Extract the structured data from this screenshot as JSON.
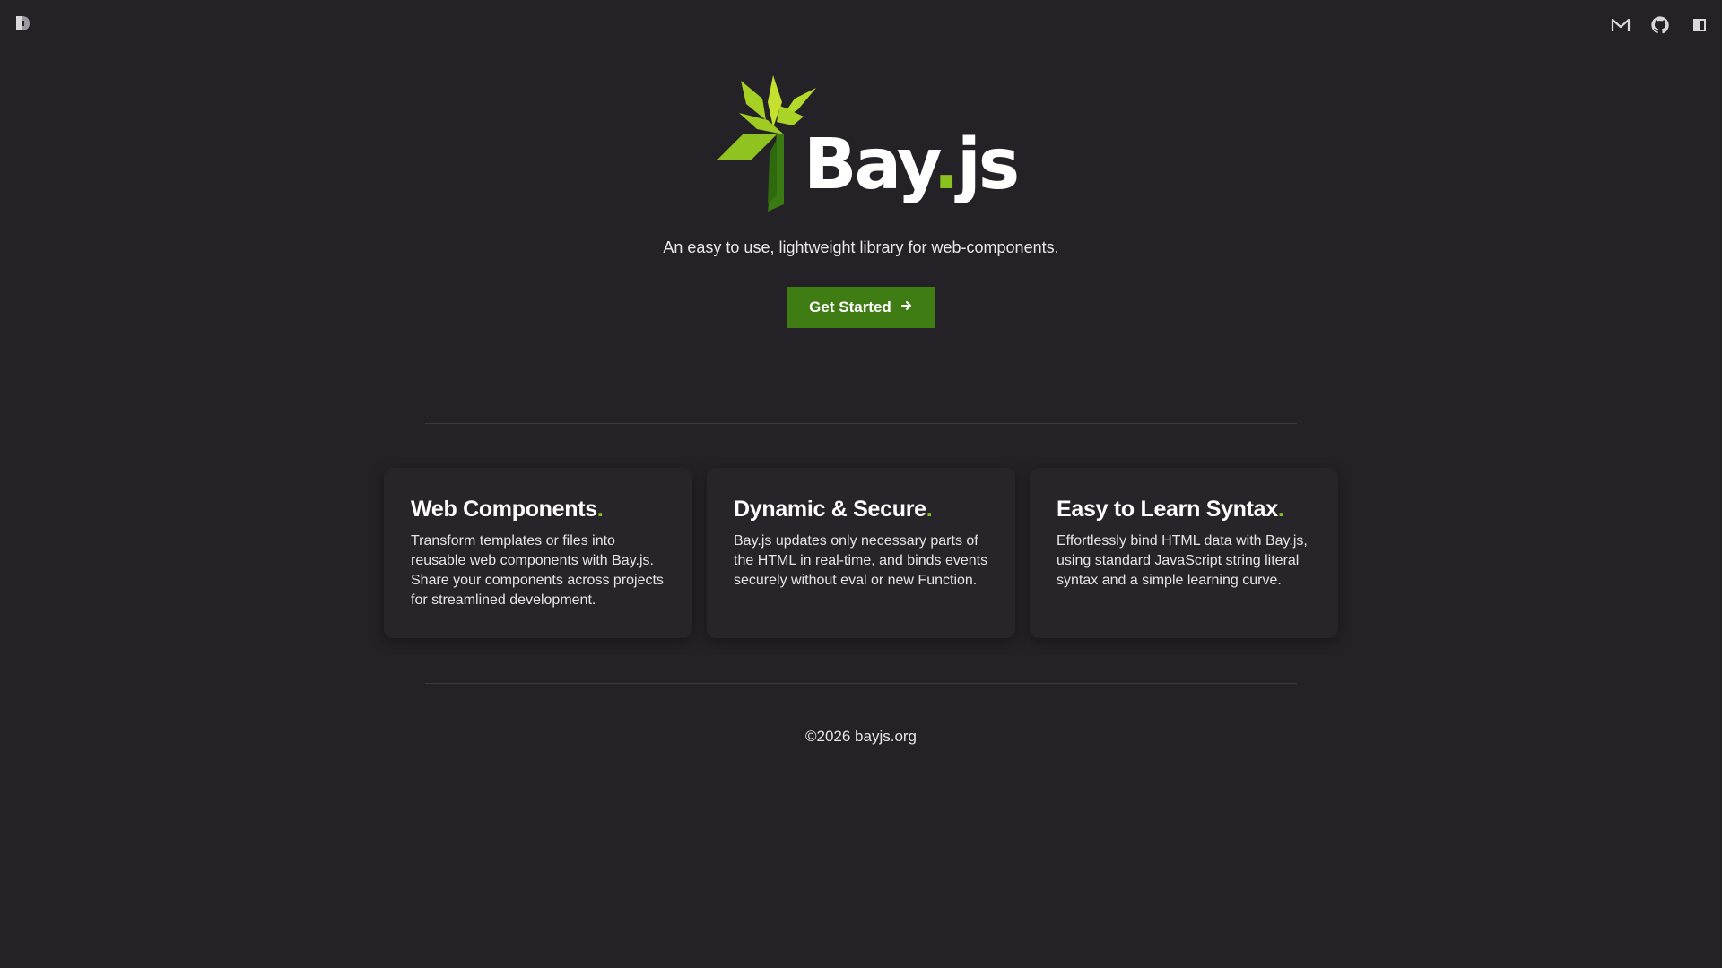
{
  "topbar": {
    "brand_icon": "bayjs-mark-icon",
    "icons": [
      "mail-icon",
      "github-icon",
      "sidebar-toggle-icon"
    ]
  },
  "hero": {
    "logo_word": "Bay",
    "logo_dot": ".",
    "logo_suffix": "js",
    "tagline": "An easy to use, lightweight library for web-components.",
    "cta_label": "Get Started",
    "cta_icon": "arrow-right-icon"
  },
  "features": [
    {
      "title": "Web Components",
      "dot": ".",
      "body": "Transform templates or files into reusable web components with Bay.js. Share your components across projects for streamlined development."
    },
    {
      "title": "Dynamic & Secure",
      "dot": ".",
      "body": "Bay.js updates only necessary parts of the HTML in real-time, and binds events securely without eval or new Function."
    },
    {
      "title": "Easy to Learn Syntax",
      "dot": ".",
      "body": "Effortlessly bind HTML data with Bay.js, using standard JavaScript string literal syntax and a simple learning curve."
    }
  ],
  "footer": {
    "copyright": "©2026 bayjs.org"
  },
  "colors": {
    "background": "#242227",
    "accent": "#8cc21e",
    "button": "#3f7d14",
    "card": "#27252a"
  }
}
